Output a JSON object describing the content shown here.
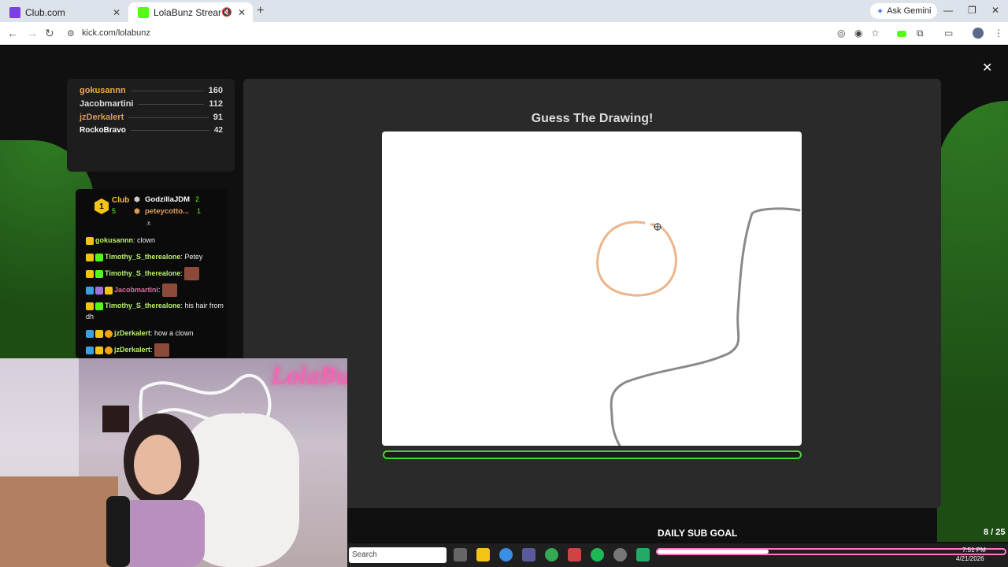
{
  "browser": {
    "tabs": [
      {
        "title": "Club.com",
        "favicon_color": "#7b3fe4",
        "active": false
      },
      {
        "title": "LolaBunz Stream - Watch Li",
        "favicon_color": "#53fc18",
        "active": true
      }
    ],
    "gemini_label": "Ask Gemini",
    "url": "kick.com/lolabunz"
  },
  "leaderboard": [
    {
      "name": "gokusannn",
      "score": "160",
      "color": "#f0a844"
    },
    {
      "name": "Jacobmartini",
      "score": "112",
      "color": "#dddddd"
    },
    {
      "name": "jzDerkalert",
      "score": "91",
      "color": "#d99a5a"
    },
    {
      "name": "RockoBravo",
      "score": "42",
      "color": "#ffffff"
    }
  ],
  "chat": {
    "pinned": {
      "rank": "1",
      "club_label": "Club",
      "club_count": "5",
      "top1_name": "GodzillaJDM",
      "top1_count": "2",
      "top2_name": "peteycotto...",
      "top2_count": "1"
    },
    "messages": [
      {
        "user": "gokusannn",
        "text": ": clown",
        "color": "#b9f06a"
      },
      {
        "user": "Timothy_S_therealone",
        "text": ": Petey",
        "color": "#b9f06a"
      },
      {
        "user": "Timothy_S_therealone",
        "text": ":",
        "color": "#b9f06a"
      },
      {
        "user": "Jacobmartini",
        "text": ":",
        "color": "#e06aa0"
      },
      {
        "user": "Timothy_S_therealone",
        "text": ": his hair from dh",
        "color": "#b9f06a"
      },
      {
        "user": "jzDerkalert",
        "text": ": how a clown",
        "color": "#b9f06a"
      },
      {
        "user": "jzDerkalert",
        "text": ":",
        "color": "#b9f06a"
      }
    ]
  },
  "game": {
    "title": "Guess The Drawing!"
  },
  "webcam": {
    "neon_sign": "LolaBunz"
  },
  "sub_goal": {
    "label": "DAILY SUB GOAL",
    "count": "8 / 25",
    "progress": 0.32
  },
  "taskbar": {
    "search_placeholder": "Search",
    "time": "7:51 PM",
    "date": "4/21/2026"
  },
  "colors": {
    "kick_green": "#53fc18",
    "progress_border": "#41d43a",
    "goal_border": "#ff79c6"
  }
}
